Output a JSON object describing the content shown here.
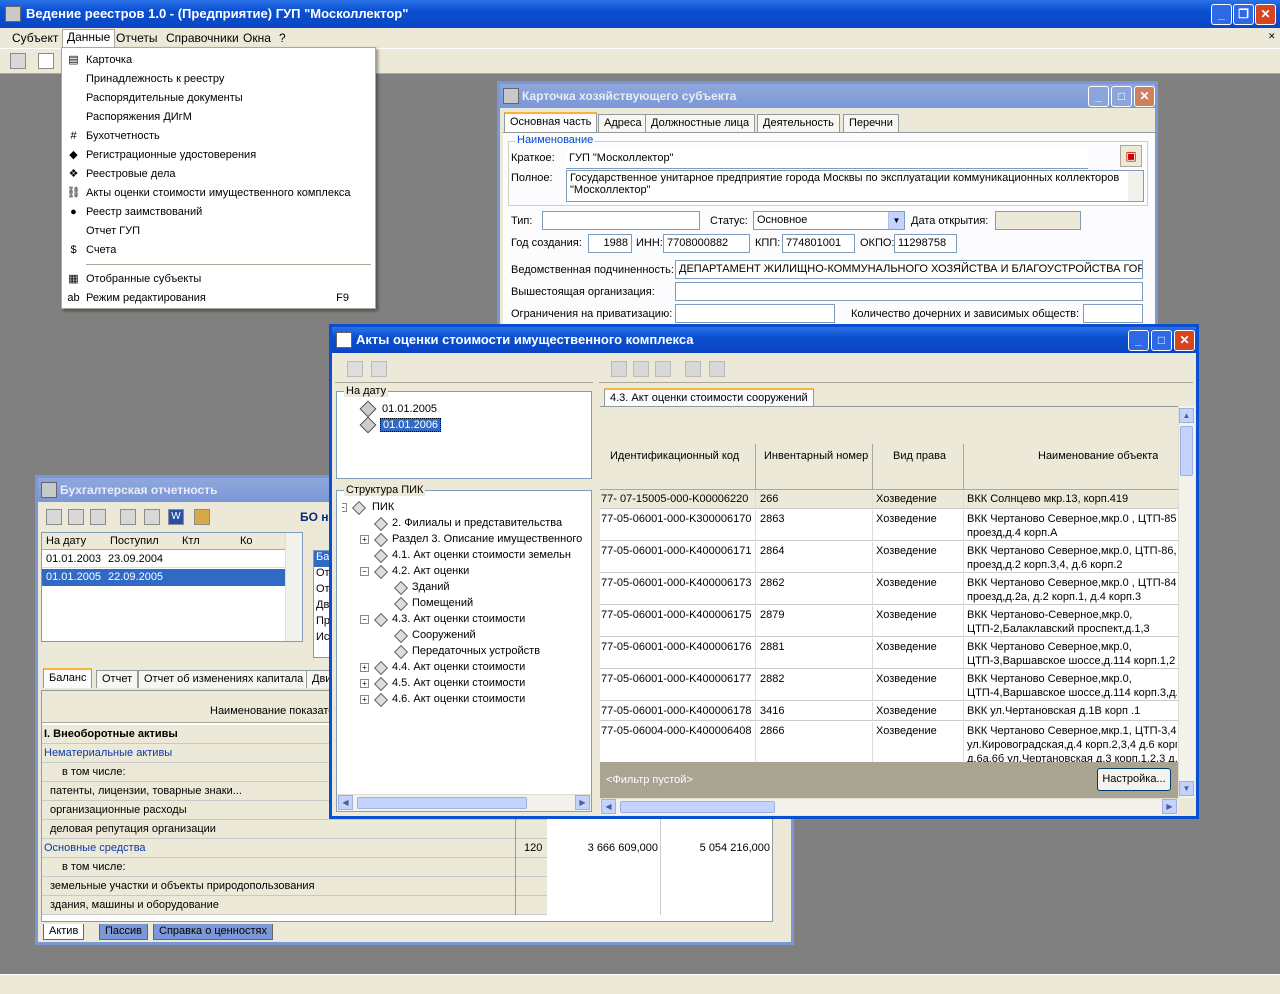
{
  "app": {
    "title": "Ведение реестров 1.0 - (Предприятие)  ГУП \"Москоллектор\"",
    "menu": [
      "Субъект",
      "Данные",
      "Отчеты",
      "Справочники",
      "Окна",
      "?"
    ]
  },
  "data_menu": {
    "items": [
      {
        "label": "Карточка",
        "icon": "card-icon"
      },
      {
        "label": "Принадлежность к реестру",
        "icon": ""
      },
      {
        "label": "Распорядительные документы",
        "icon": ""
      },
      {
        "label": "Распоряжения ДИгМ",
        "icon": ""
      },
      {
        "label": "Бухотчетность",
        "icon": "grid-hash-icon"
      },
      {
        "label": "Регистрационные удостоверения",
        "icon": "diamond-icon"
      },
      {
        "label": "Реестровые дела",
        "icon": "folder-icon"
      },
      {
        "label": "Акты оценки стоимости имущественного комплекса",
        "icon": "chain-icon"
      },
      {
        "label": "Реестр заимствований",
        "icon": "coins-icon"
      },
      {
        "label": "Отчет ГУП",
        "icon": ""
      },
      {
        "label": "Счета",
        "icon": "dollar-icon"
      },
      {
        "label": "Отобранные субъекты",
        "icon": "table-icon"
      },
      {
        "label": "Режим редактирования",
        "icon": "text-edit-icon",
        "shortcut": "F9"
      }
    ]
  },
  "card": {
    "title": "Карточка хозяйствующего субъекта",
    "tabs": [
      "Основная часть",
      "Адреса",
      "Должностные лица",
      "Деятельность",
      "Перечни"
    ],
    "group_label": "Наименование",
    "short_label": "Краткое:",
    "short_value": "ГУП \"Москоллектор\"",
    "full_label": "Полное:",
    "full_value_line1": "Государственное унитарное предприятие города Москвы по эксплуатации коммуникационных коллекторов",
    "full_value_line2": "\"Москоллектор\"",
    "type_label": "Тип:",
    "type_value": "",
    "status_label": "Статус:",
    "status_value": "Основное",
    "open_date_label": "Дата открытия:",
    "open_date_value": "",
    "year_label": "Год создания:",
    "year_value": "1988",
    "inn_label": "ИНН:",
    "inn_value": "7708000882",
    "kpp_label": "КПП:",
    "kpp_value": "774801001",
    "okpo_label": "ОКПО:",
    "okpo_value": "11298758",
    "dept_label": "Ведомственная подчиненность:",
    "dept_value": "ДЕПАРТАМЕНТ ЖИЛИЩНО-КОММУНАЛЬНОГО ХОЗЯЙСТВА И БЛАГОУСТРОЙСТВА ГОР",
    "parent_label": "Вышестоящая организация:",
    "parent_value": "",
    "priv_label": "Ограничения на приватизацию:",
    "priv_value": "",
    "subs_label": "Количество дочерних и зависимых обществ:",
    "subs_value": ""
  },
  "acts": {
    "title": "Акты оценки стоимости имущественного комплекса",
    "date_group": "На дату",
    "dates": [
      "01.01.2005",
      "01.01.2006"
    ],
    "struct_group": "Структура ПИК",
    "tree": [
      {
        "label": "ПИК",
        "level": 0,
        "expander": "−"
      },
      {
        "label": "2. Филиалы и представительства",
        "level": 1,
        "expander": ""
      },
      {
        "label": "Раздел 3. Описание имущественного",
        "level": 1,
        "expander": "+"
      },
      {
        "label": "4.1. Акт оценки стоимости земельн",
        "level": 1,
        "expander": ""
      },
      {
        "label": "4.2. Акт оценки",
        "level": 1,
        "expander": "−"
      },
      {
        "label": "Зданий",
        "level": 2,
        "expander": ""
      },
      {
        "label": "Помещений",
        "level": 2,
        "expander": ""
      },
      {
        "label": "4.3. Акт оценки стоимости",
        "level": 1,
        "expander": "−"
      },
      {
        "label": "Сооружений",
        "level": 2,
        "expander": ""
      },
      {
        "label": "Передаточных устройств",
        "level": 2,
        "expander": ""
      },
      {
        "label": "4.4. Акт оценки стоимости",
        "level": 1,
        "expander": "+"
      },
      {
        "label": "4.5. Акт оценки стоимости",
        "level": 1,
        "expander": "+"
      },
      {
        "label": "4.6. Акт оценки стоимости",
        "level": 1,
        "expander": "+"
      }
    ],
    "tab": "4.3. Акт оценки стоимости сооружений",
    "columns": [
      "Идентификационный код",
      "Инвентарный номер",
      "Вид права",
      "Наименование объекта"
    ],
    "rows": [
      {
        "code": "77- 07-15005-000-K00006220",
        "inv": "266",
        "right": "Хозведение",
        "name": [
          "ВКК Солнцево мкр.13, корп.419"
        ]
      },
      {
        "code": "77-05-06001-000-K300006170",
        "inv": "2863",
        "right": "Хозведение",
        "name": [
          "ВКК Чертаново Северное,мкр.0 ,  ЦТП-85,",
          "проезд,д.4 корп.А"
        ]
      },
      {
        "code": "77-05-06001-000-K400006171",
        "inv": "2864",
        "right": "Хозведение",
        "name": [
          "ВКК Чертаново Северное,мкр.0, ЦТП-86,",
          "проезд,д.2 корп.3,4, д.6 корп.2"
        ]
      },
      {
        "code": "77-05-06001-000-K400006173",
        "inv": "2862",
        "right": "Хозведение",
        "name": [
          "ВКК Чертаново Северное,мкр.0 , ЦТП-84,",
          "проезд,д.2а, д.2 корп.1, д.4 корп.3"
        ]
      },
      {
        "code": "77-05-06001-000-K400006175",
        "inv": "2879",
        "right": "Хозведение",
        "name": [
          "ВКК Чертаново-Северное,мкр.0,",
          "ЦТП-2,Балаклавский проспект,д.1,3"
        ]
      },
      {
        "code": "77-05-06001-000-K400006176",
        "inv": "2881",
        "right": "Хозведение",
        "name": [
          "ВКК Чертаново Северное,мкр.0,",
          "ЦТП-3,Варшавское шоссе,д.114 корп.1,2"
        ]
      },
      {
        "code": "77-05-06001-000-K400006177",
        "inv": "2882",
        "right": "Хозведение",
        "name": [
          "ВКК Чертаново Северное,мкр.0,",
          "ЦТП-4,Варшавское шоссе,д.114 корп.3,д."
        ]
      },
      {
        "code": "77-05-06001-000-K400006178",
        "inv": "3416",
        "right": "Хозведение",
        "name": [
          "ВКК ул.Чертановская д.1В корп .1"
        ]
      },
      {
        "code": "77-05-06004-000-K400006408",
        "inv": "2866",
        "right": "Хозведение",
        "name": [
          "ВКК Чертаново Северное,мкр.1,  ЦТП-3,4,",
          "ул.Кировоградская,д.4 корп.2,3,4 д.6 корп",
          "д.6а,6б  ул.Чертановская д.3 корп.1,2,3  д."
        ]
      }
    ],
    "filter_text": "<Фильтр пустой>",
    "settings_button": "Настройка..."
  },
  "buh": {
    "title": "Бухгалтерская отчетность",
    "toolbar_text": "БО на",
    "columns": [
      "На дату",
      "Поступил",
      "Ктл",
      "Ко"
    ],
    "rows": [
      [
        "01.01.2003",
        "23.09.2004",
        "",
        ""
      ],
      [
        "01.01.2005",
        "22.09.2005",
        "",
        ""
      ]
    ],
    "side_list": [
      "Ба",
      "Отч",
      "Отч",
      "Дв",
      "Пр",
      "Ис"
    ],
    "tabs": [
      "Баланс",
      "Отчет",
      "Отчет об изменениях капитала",
      "Дви"
    ],
    "table_header": "Наименование показате",
    "table_rows": [
      {
        "name": "I. Внеоборотные активы",
        "code": "",
        "v1": "",
        "v2": "",
        "style": "bold"
      },
      {
        "name": "Нематериальные активы",
        "code": "",
        "v1": "",
        "v2": "",
        "style": "link"
      },
      {
        "name": "в том числе:",
        "code": "",
        "v1": "",
        "v2": "",
        "style": "indent"
      },
      {
        "name": "патенты, лицензии, товарные знаки...",
        "code": "",
        "v1": "",
        "v2": "",
        "style": ""
      },
      {
        "name": "организационные расходы",
        "code": "",
        "v1": "",
        "v2": "",
        "style": ""
      },
      {
        "name": "деловая репутация организации",
        "code": "",
        "v1": "",
        "v2": "",
        "style": ""
      },
      {
        "name": "Основные средства",
        "code": "120",
        "v1": "3 666 609,000",
        "v2": "5 054 216,000",
        "style": "link"
      },
      {
        "name": "в том числе:",
        "code": "",
        "v1": "",
        "v2": "",
        "style": "indent"
      },
      {
        "name": "земельные участки и объекты природопользования",
        "code": "",
        "v1": "",
        "v2": "",
        "style": ""
      },
      {
        "name": "здания, машины и оборудование",
        "code": "",
        "v1": "",
        "v2": "",
        "style": ""
      }
    ],
    "bottom_tabs": [
      "Актив",
      "Пассив",
      "Справка о ценностях"
    ]
  }
}
